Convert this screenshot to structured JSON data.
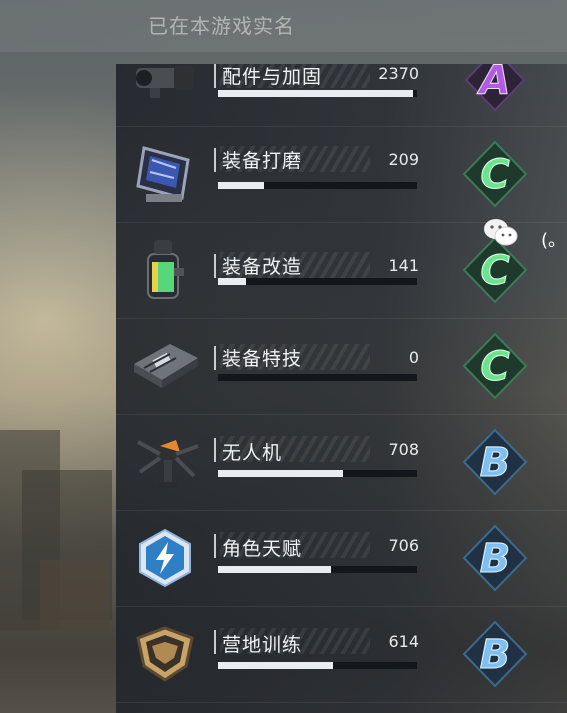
{
  "header": {
    "tip": "已在本游戏实名"
  },
  "items": [
    {
      "name": "配件与加固",
      "value": "2370",
      "progress": 0.98,
      "grade": "A",
      "icon": "scope-icon"
    },
    {
      "name": "装备打磨",
      "value": "209",
      "progress": 0.23,
      "grade": "C",
      "icon": "whetstone-icon"
    },
    {
      "name": "装备改造",
      "value": "141",
      "progress": 0.14,
      "grade": "C",
      "icon": "canister-icon"
    },
    {
      "name": "装备特技",
      "value": "0",
      "progress": 0.0,
      "grade": "C",
      "icon": "chip-icon"
    },
    {
      "name": "无人机",
      "value": "708",
      "progress": 0.63,
      "grade": "B",
      "icon": "drone-icon"
    },
    {
      "name": "角色天赋",
      "value": "706",
      "progress": 0.57,
      "grade": "B",
      "icon": "lightning-hex-icon"
    },
    {
      "name": "营地训练",
      "value": "614",
      "progress": 0.58,
      "grade": "B",
      "icon": "camp-badge-icon"
    }
  ],
  "side": {
    "text": "(。"
  },
  "colors": {
    "A": "#b05ce0",
    "B": "#7ec1f0",
    "C": "#6ce48e",
    "panel": "#22262c"
  }
}
